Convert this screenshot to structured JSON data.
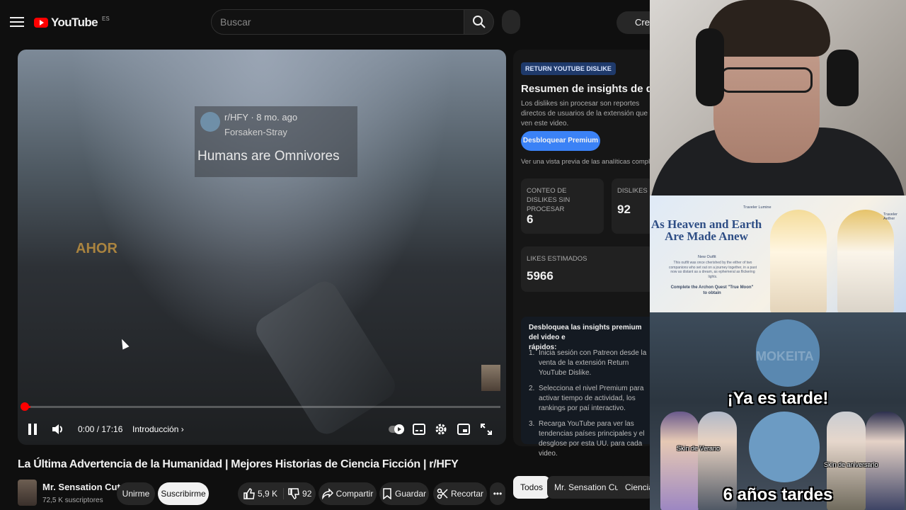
{
  "header": {
    "logo_text": "YouTube",
    "country_code": "ES",
    "search_placeholder": "Buscar",
    "create_label": "Crear"
  },
  "player": {
    "overlay_user": "r/HFY",
    "overlay_time": "8 mo. ago",
    "overlay_sub": "Forsaken-Stray",
    "overlay_title": "Humans are Omnivores",
    "overlay_ingame_text": "AHOR",
    "progress": 0.002,
    "time": "0:00 / 17:16",
    "chapter": "Introducción"
  },
  "video": {
    "title": "La Última Advertencia de la Humanidad | Mejores Historias de Ciencia Ficción | r/HFY",
    "channel_name": "Mr. Sensation Cuts",
    "subscribers": "72,5 K suscriptores",
    "join_label": "Unirme",
    "subscribe_label": "Suscribirme",
    "likes": "5,9 K",
    "dislikes": "92",
    "share_label": "Compartir",
    "save_label": "Guardar",
    "clip_label": "Recortar"
  },
  "dislike_panel": {
    "tag": "RETURN YOUTUBE DISLIKE",
    "title": "Resumen de insights de dislikes",
    "description": "Los dislikes sin procesar son reportes directos de usuarios de la extensión que ven este video.",
    "unlock_label": "Desbloquear Premium",
    "preview_text": "Ver una vista previa de las analíticas completas",
    "stat1_label": "CONTEO DE DISLIKES SIN PROCESAR",
    "stat1_value": "6",
    "stat2_label": "DISLIKES E",
    "stat2_value": "92",
    "stat3_label": "LIKES ESTIMADOS",
    "stat3_value": "5966",
    "premium_heading": "Desbloquea las insights premium del video e\nrápidos:",
    "steps": [
      "Inicia sesión con Patreon desde la venta de la extensión Return YouTube Dislike.",
      "Selecciona el nivel Premium para activar tiempo de actividad, los rankings por paí interactivo.",
      "Recarga YouTube para ver las tendencias países principales y el desglose por esta UU. para cada video."
    ]
  },
  "chips": [
    "Todos",
    "Mr. Sensation Cuts",
    "Ciencia f"
  ],
  "stream_overlays": {
    "genshin_title": "As Heaven and Earth Are Made Anew",
    "genshin_tag_left": "Traveler Lumine",
    "genshin_tag_right": "Traveler Aether",
    "genshin_outfit": "New Outfit",
    "genshin_small": "This outfit was once cherished by the either of two companions who set out on a journey together, in a past now as distant as a dream, as ephemeral as flickering lights.",
    "genshin_quest": "Complete the Archon Quest \"True Moon\" to obtain",
    "meme_top": "¡Ya es tarde!",
    "meme_bottom": "6 años tardes",
    "skin_left": "Skin de Verano",
    "skin_right": "Skin de aniversario",
    "watermark": "MOKEITA"
  },
  "colors": {
    "background": "#0f0f0f",
    "brand_red": "#ff0000",
    "accent_blue": "#3b82f6"
  }
}
